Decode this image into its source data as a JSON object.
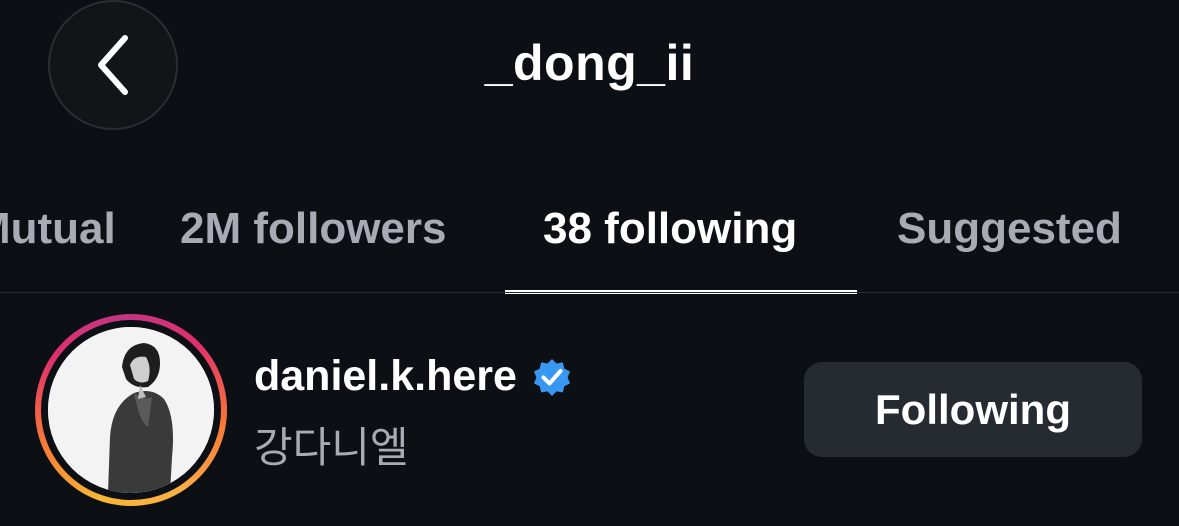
{
  "header": {
    "title": "_dong_ii",
    "back_icon": "chevron-left-icon"
  },
  "tabs": [
    {
      "label": "Mutual"
    },
    {
      "label": "2M followers"
    },
    {
      "label": "38 following",
      "active": true
    },
    {
      "label": "Suggested"
    }
  ],
  "list": {
    "items": [
      {
        "username": "daniel.k.here",
        "verified": true,
        "full_name": "강다니엘",
        "button_label": "Following"
      }
    ]
  },
  "colors": {
    "background": "#0c0f14",
    "verified_badge": "#3897f0",
    "button_bg": "#262a31",
    "muted_text": "#a8abb3"
  }
}
